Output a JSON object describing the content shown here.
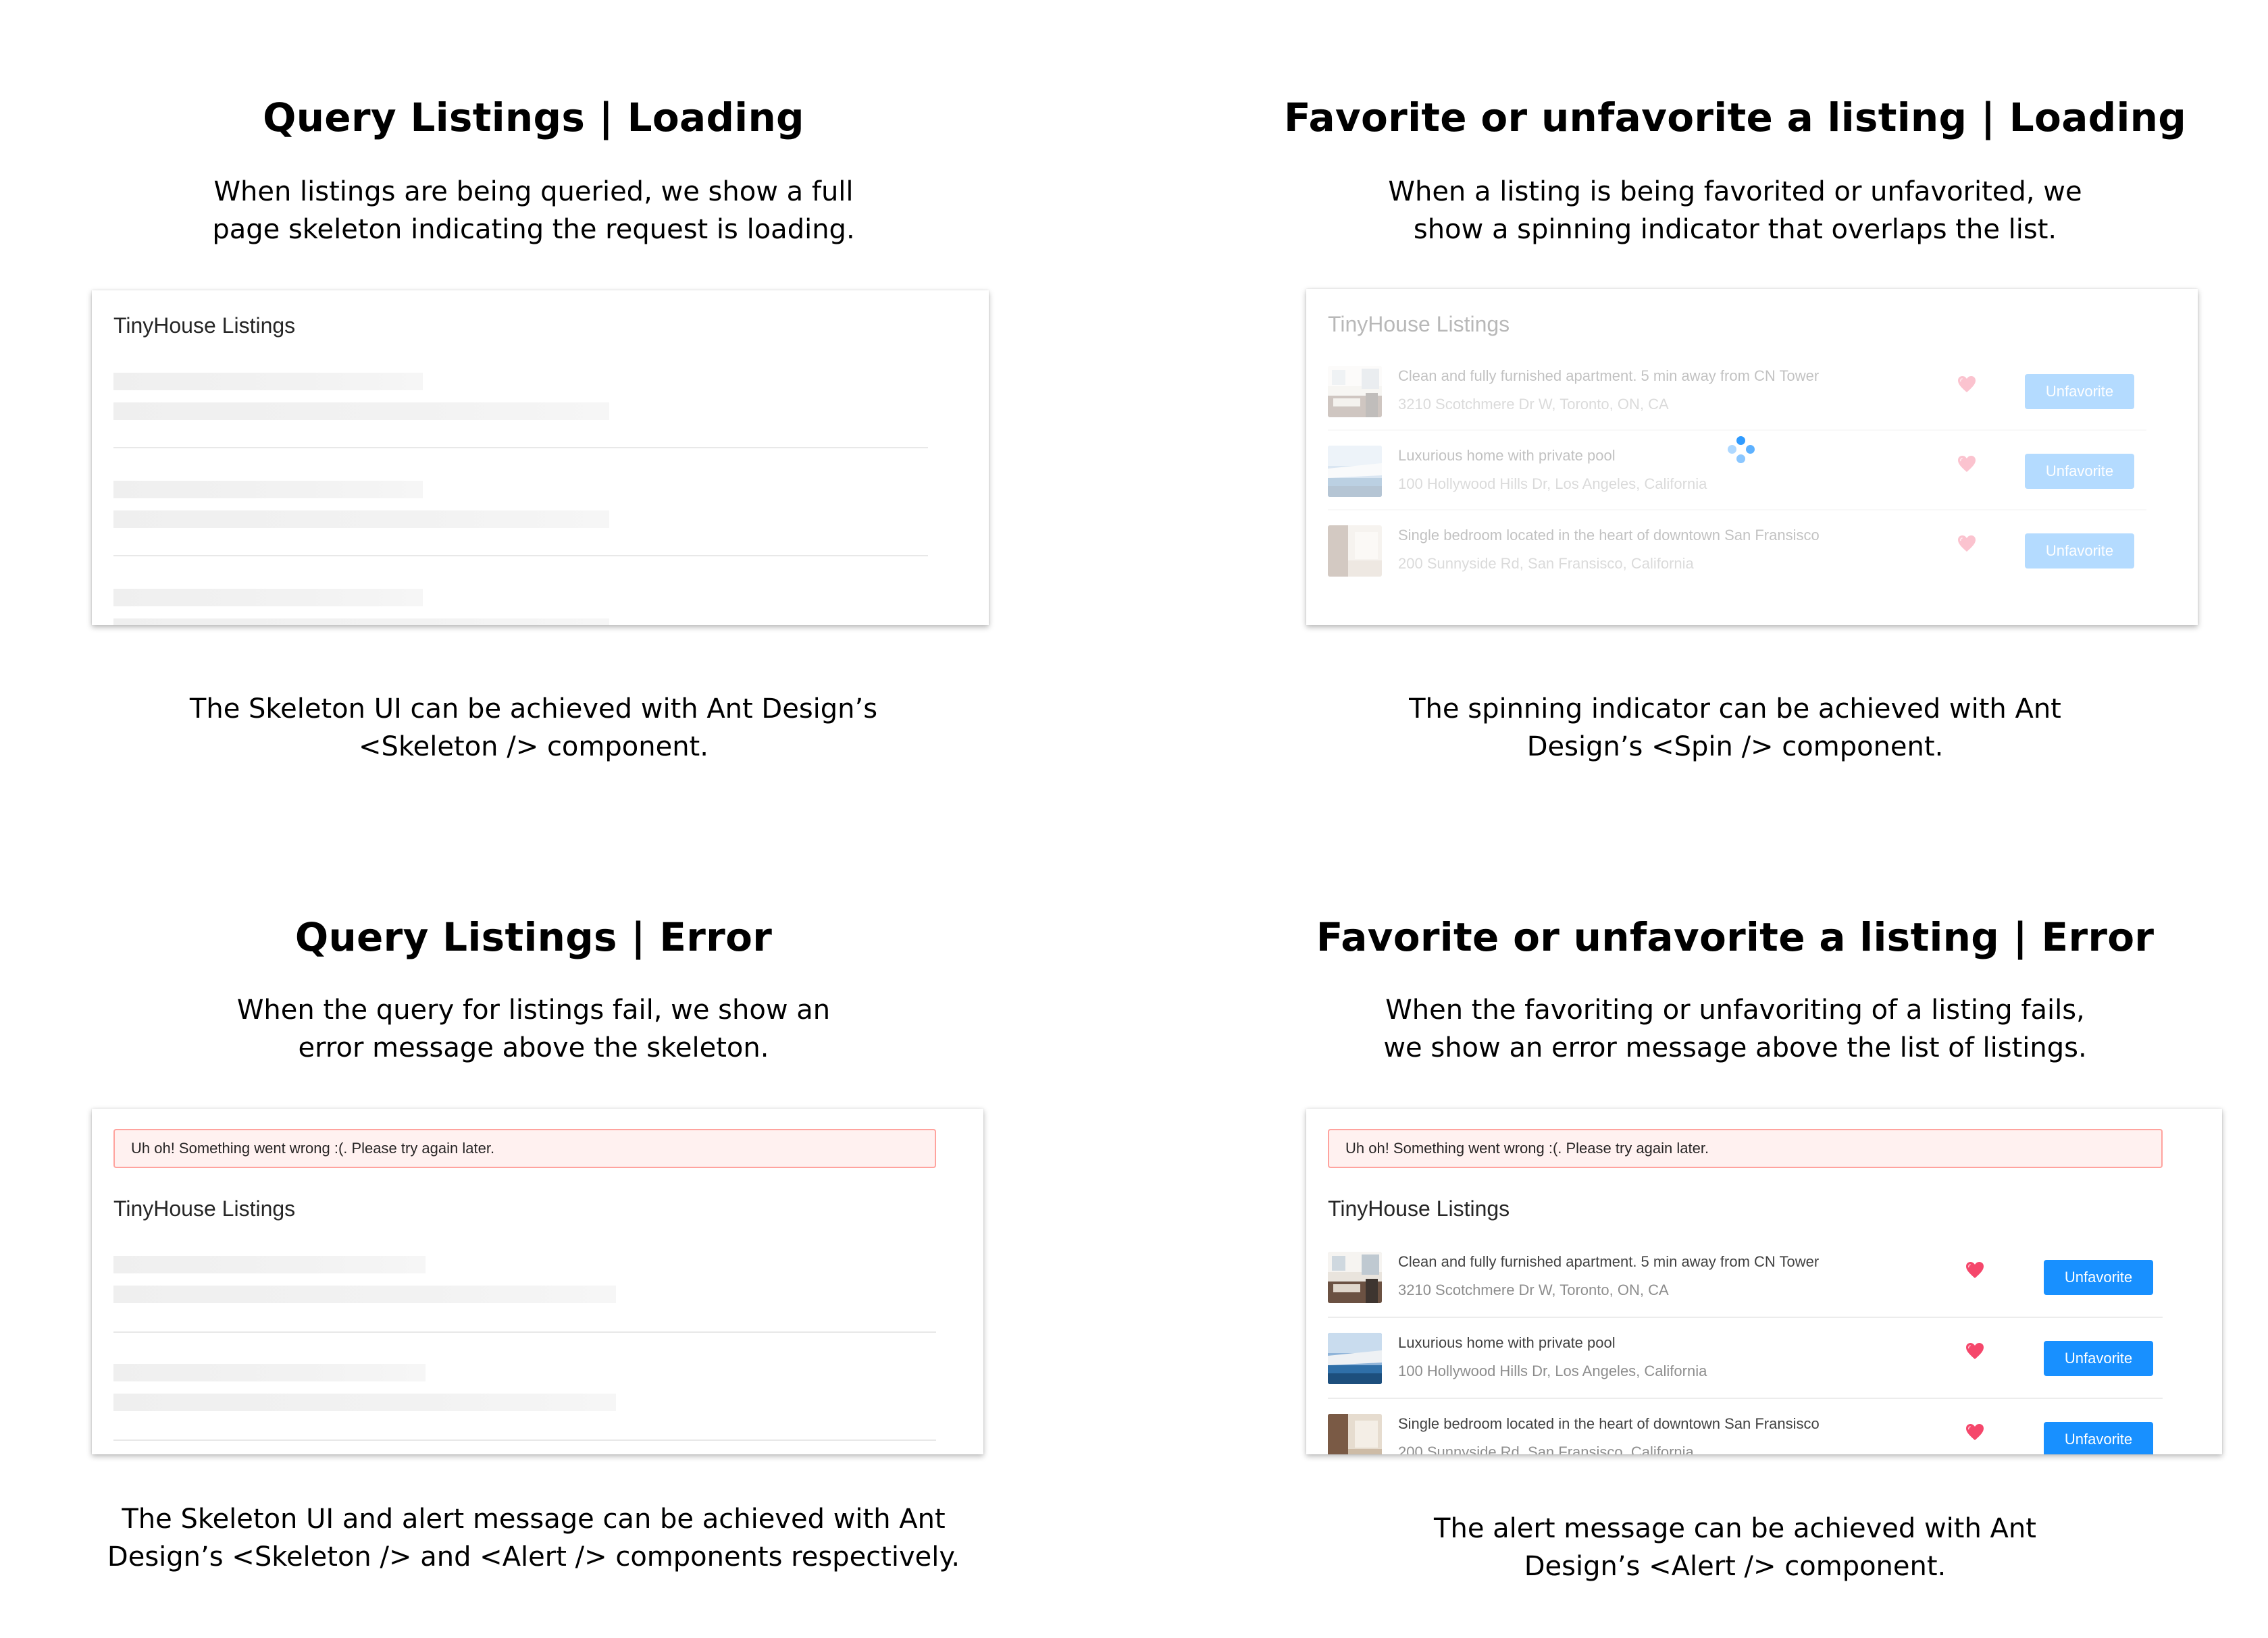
{
  "sections": {
    "query_loading": {
      "title": "Query Listings | Loading",
      "desc_line1": "When listings are being queried, we show a full",
      "desc_line2": "page skeleton indicating the request is loading.",
      "note_line1": "The Skeleton UI can be achieved with Ant Design’s",
      "note_line2": "<Skeleton /> component.",
      "card_title": "TinyHouse Listings"
    },
    "favorite_loading": {
      "title": "Favorite or unfavorite a listing | Loading",
      "desc_line1": "When a listing is being favorited or unfavorited, we",
      "desc_line2": "show a spinning indicator that overlaps the list.",
      "note_line1": "The spinning indicator can be achieved with Ant",
      "note_line2": "Design’s <Spin /> component.",
      "card_title": "TinyHouse Listings"
    },
    "query_error": {
      "title": "Query Listings | Error",
      "desc_line1": "When the query for listings fail, we show an",
      "desc_line2": "error message above the skeleton.",
      "note_line1": "The Skeleton UI and alert message can be achieved with Ant",
      "note_line2": "Design’s <Skeleton /> and <Alert /> components respectively.",
      "alert_text": "Uh oh! Something went wrong :(. Please try again later.",
      "card_title": "TinyHouse Listings"
    },
    "favorite_error": {
      "title": "Favorite or unfavorite a listing | Error",
      "desc_line1": "When the favoriting or unfavoriting of a listing fails,",
      "desc_line2": "we show an error message above the list of listings.",
      "note_line1": "The alert message can be achieved with Ant",
      "note_line2": "Design’s <Alert /> component.",
      "alert_text": "Uh oh! Something went wrong :(. Please try again later.",
      "card_title": "TinyHouse Listings"
    }
  },
  "listings": [
    {
      "title": "Clean and fully furnished apartment. 5 min away from CN Tower",
      "address": "3210 Scotchmere Dr W, Toronto, ON, CA",
      "button_label": "Unfavorite"
    },
    {
      "title": "Luxurious home with private pool",
      "address": "100 Hollywood Hills Dr, Los Angeles, California",
      "button_label": "Unfavorite"
    },
    {
      "title": "Single bedroom located in the heart of downtown San Fransisco",
      "address": "200 Sunnyside Rd, San Fransisco, California",
      "button_label": "Unfavorite"
    }
  ],
  "colors": {
    "primary": "#1890ff",
    "alert_bg": "#fff1f0",
    "alert_border": "#ffa39e",
    "heart": "#eb2f96"
  },
  "icons": {
    "favorite": "heart-icon",
    "loading": "spinner-icon"
  }
}
